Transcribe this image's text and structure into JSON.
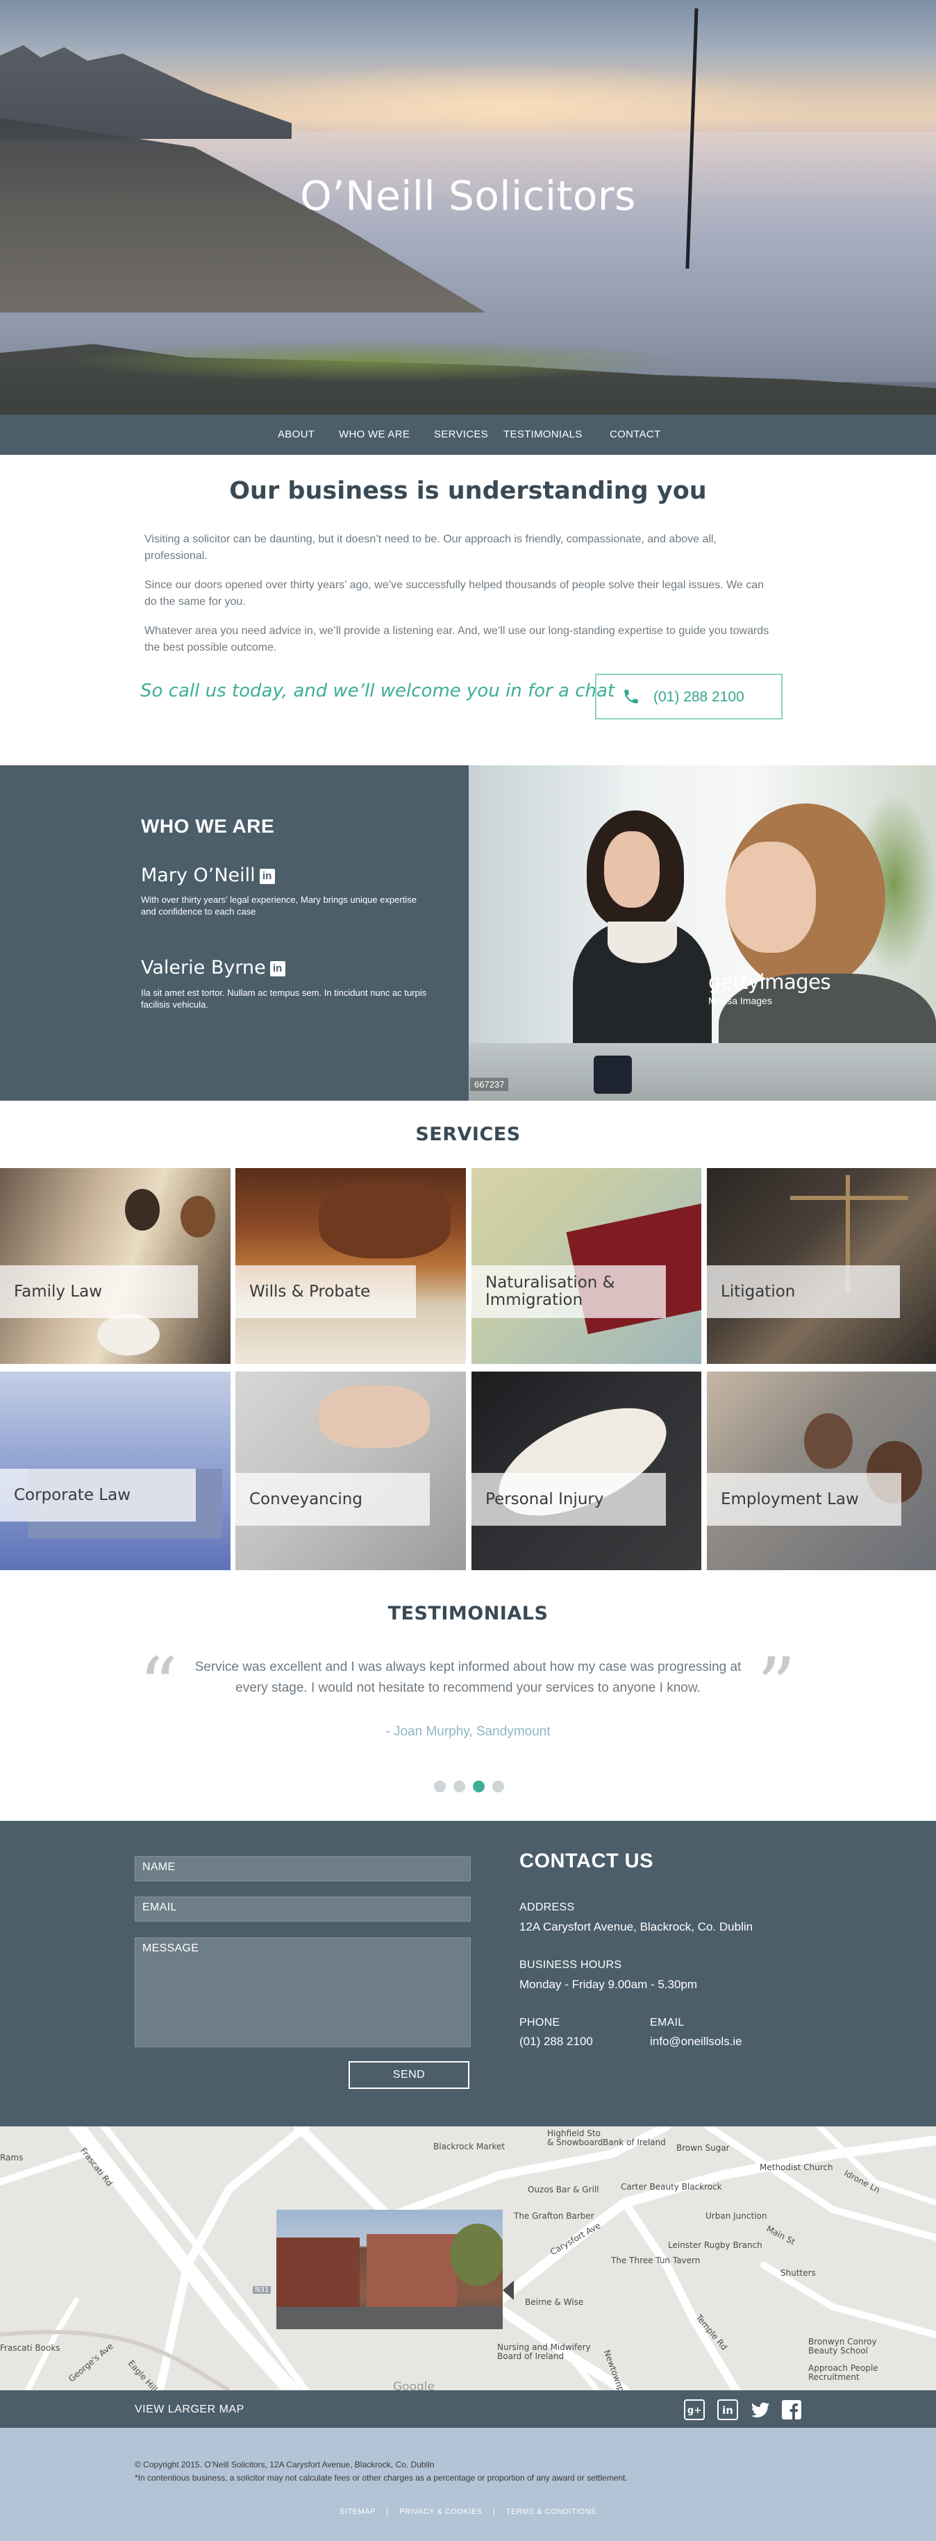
{
  "hero": {
    "title": "O’Neill Solicitors"
  },
  "nav": {
    "items": [
      "ABOUT",
      "WHO WE ARE",
      "SERVICES",
      "TESTIMONIALS",
      "CONTACT"
    ]
  },
  "intro": {
    "title": "Our business is understanding you",
    "paragraphs": [
      "Visiting a solicitor can be daunting, but it doesn’t need to be. Our approach is friendly, compassionate, and above all, professional.",
      "Since our doors opened over thirty years’ ago, we’ve successfully helped thousands of people solve their legal issues. We can do the same for you.",
      "Whatever area you need advice in, we’ll provide a listening ear. And, we’ll use our long-standing expertise to guide you towards the best possible outcome."
    ],
    "cta_text": "So call us today, and we’ll welcome you in for a chat",
    "phone": "(01) 288 2100"
  },
  "who": {
    "title": "WHO WE ARE",
    "people": [
      {
        "name": "Mary O’Neill",
        "linkedin": "in",
        "desc": "With over thirty years’ legal experience, Mary brings unique expertise and confidence to each case"
      },
      {
        "name": "Valerie Byrne",
        "linkedin": "in",
        "desc": "Ila sit amet est tortor. Nullam ac tempus sem. In tincidunt nunc ac turpis facilisis vehicula."
      }
    ],
    "photo_watermark": "gettyimages",
    "photo_watermark_sub": "Monsa Images",
    "photo_code": "667237"
  },
  "services": {
    "title": "SERVICES",
    "items": [
      {
        "label": "Family Law",
        "icon": "family-image"
      },
      {
        "label": "Wills & Probate",
        "icon": "wills-image"
      },
      {
        "label": "Naturalisation & Immigration",
        "icon": "passport-map-image"
      },
      {
        "label": "Litigation",
        "icon": "scales-image"
      },
      {
        "label": "Corporate Law",
        "icon": "boardroom-image"
      },
      {
        "label": "Conveyancing",
        "icon": "house-keys-image"
      },
      {
        "label": "Personal Injury",
        "icon": "bandaged-arm-image"
      },
      {
        "label": "Employment Law",
        "icon": "office-meeting-image"
      }
    ]
  },
  "testimonials": {
    "title": "TESTIMONIALS",
    "quote": "Service was excellent and I was always kept informed about how my case was progressing at every stage. I would not hesitate to recommend your services to anyone I know.",
    "author": "- Joan Murphy, Sandymount",
    "open_mark": "“",
    "close_mark": "”",
    "active_slide": 3,
    "slide_count": 4
  },
  "contact": {
    "form": {
      "name": "NAME",
      "email": "EMAIL",
      "message": "MESSAGE",
      "send": "SEND"
    },
    "title": "CONTACT US",
    "address_label": "ADDRESS",
    "address": "12A Carysfort Avenue, Blackrock, Co. Dublin",
    "hours_label": "BUSINESS HOURS",
    "hours": "Monday - Friday 9.00am - 5.30pm",
    "phone_label": "PHONE",
    "phone": "(01) 288 2100",
    "email_label": "EMAIL",
    "email": "info@oneillsols.ie"
  },
  "map": {
    "labels": [
      "Frascati Rd",
      "Blackrock Market",
      "Highfield Sto & Snowboard",
      "Bank of Ireland",
      "Brown Sugar",
      "Methodist Church",
      "Idrone Ln",
      "Carter Beauty Blackrock",
      "Ouzos Bar & Grill",
      "The Grafton Barber",
      "Urban Junction",
      "Main St",
      "Carysfort Ave",
      "Leinster Rugby Branch",
      "The Three Tun Tavern",
      "Shutters",
      "Beirne & Wise",
      "Nursing and Midwifery Board of Ireland",
      "Temple Rd",
      "Bronwyn Conroy Beauty School",
      "Approach People Recruitment",
      "Eagle Hill",
      "George's Ave",
      "Newtownpark Ave",
      "Frascati Books",
      "Rams"
    ],
    "google": "Google",
    "road_code": "N31"
  },
  "footer_bar": {
    "view_map": "VIEW LARGER MAP",
    "social": [
      "google-plus-icon",
      "linkedin-icon",
      "twitter-icon",
      "facebook-icon"
    ]
  },
  "footer": {
    "copyright": "© Copyright 2015. O’Neill Solicitors, 12A Carysfort Avenue, Blackrock, Co. Dublin",
    "disclaimer": "*In contentious business, a solicitor may not calculate fees or other charges as a percentage or proportion of any award or settlement.",
    "links": [
      "SITEMAP",
      "PRIVACY & COOKIES",
      "TERMS & CONDITIONS"
    ],
    "separator": "|"
  },
  "colors": {
    "slate": "#4b5e6a",
    "teal": "#3eae96",
    "footer_blue": "#b2c4d5"
  }
}
